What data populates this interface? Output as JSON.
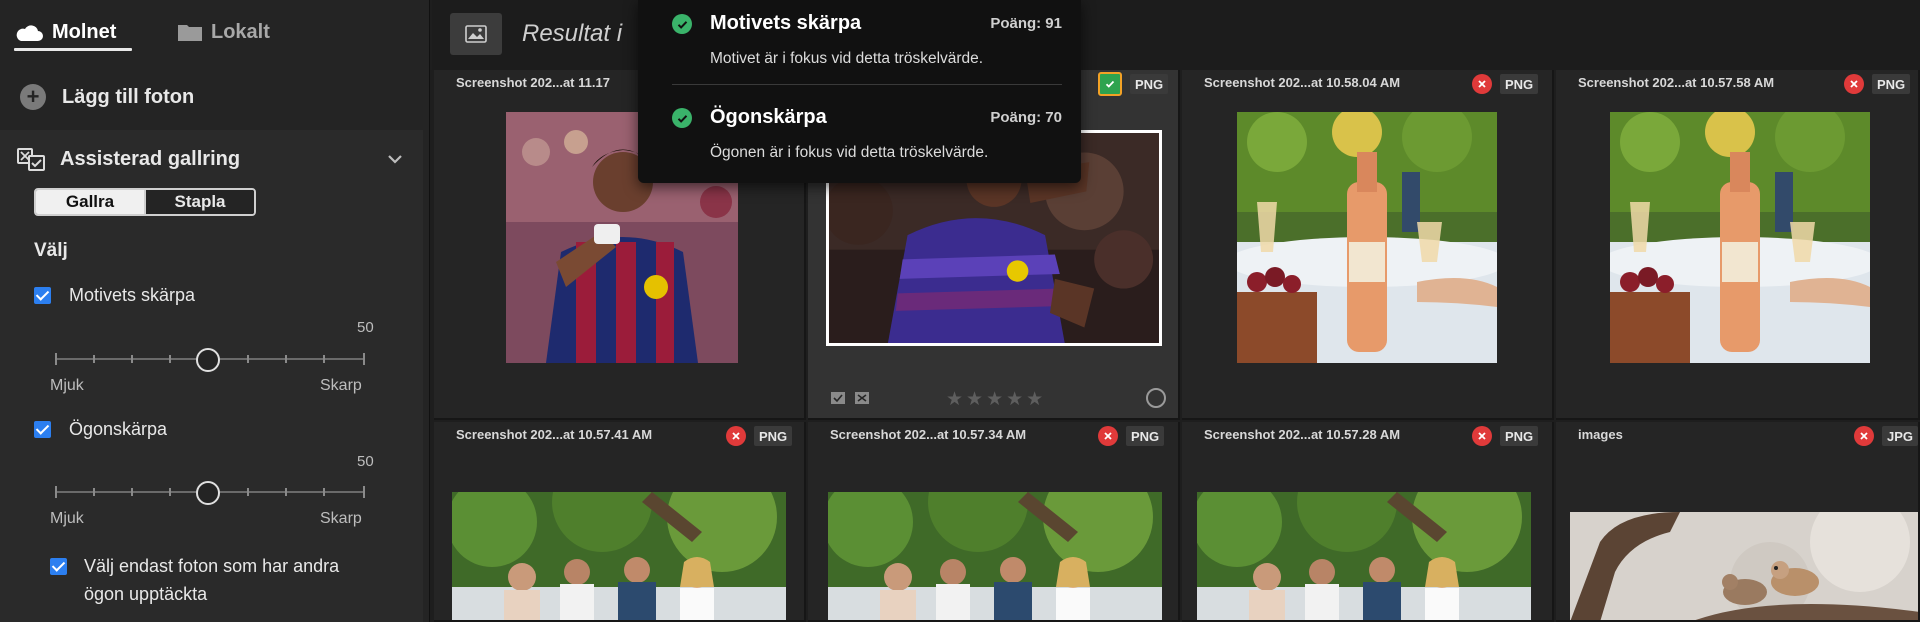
{
  "sidebar": {
    "tabs": [
      {
        "label": "Molnet",
        "active": true,
        "icon": "cloud-icon"
      },
      {
        "label": "Lokalt",
        "active": false,
        "icon": "folder-icon"
      }
    ],
    "add_photos_label": "Lägg till foton",
    "assisted_culling": {
      "title": "Assisterad gallring",
      "mode_options": [
        {
          "label": "Gallra",
          "selected": true
        },
        {
          "label": "Stapla",
          "selected": false
        }
      ],
      "select_label": "Välj",
      "criteria": [
        {
          "label": "Motivets skärpa",
          "checked": true,
          "value": "50",
          "value_level": 0.5,
          "min_label": "Mjuk",
          "max_label": "Skarp"
        },
        {
          "label": "Ögonskärpa",
          "checked": true,
          "value": "50",
          "value_level": 0.5,
          "min_label": "Mjuk",
          "max_label": "Skarp"
        }
      ],
      "eyes_only_label": "Välj endast foton som har andra ögon upptäckta",
      "eyes_only_checked": true
    }
  },
  "main": {
    "results_title": "Resultat i",
    "grid": [
      {
        "name": "Screenshot 202...at 11.17",
        "status": "none",
        "type": "",
        "image": "soccer-celebration"
      },
      {
        "name": "",
        "status": "accepted",
        "type": "PNG",
        "image": "soccer-player",
        "selected": true,
        "rating": "★★★★★"
      },
      {
        "name": "Screenshot 202...at 10.58.04 AM",
        "status": "rejected",
        "type": "PNG",
        "image": "wine-table"
      },
      {
        "name": "Screenshot 202...at 10.57.58 AM",
        "status": "rejected",
        "type": "PNG",
        "image": "wine-table"
      },
      {
        "name": "Screenshot 202...at 10.57.41 AM",
        "status": "rejected",
        "type": "PNG",
        "image": "group-dinner"
      },
      {
        "name": "Screenshot 202...at 10.57.34 AM",
        "status": "rejected",
        "type": "PNG",
        "image": "group-dinner"
      },
      {
        "name": "Screenshot 202...at 10.57.28 AM",
        "status": "rejected",
        "type": "PNG",
        "image": "group-dinner"
      },
      {
        "name": "images",
        "status": "rejected",
        "type": "JPG",
        "image": "birds-branch"
      }
    ]
  },
  "tooltip": {
    "items": [
      {
        "title": "Motivets skärpa",
        "score": "Poäng: 91",
        "desc": "Motivet är i fokus vid detta tröskelvärde."
      },
      {
        "title": "Ögonskärpa",
        "score": "Poäng: 70",
        "desc": "Ögonen är i fokus vid detta tröskelvärde."
      }
    ]
  },
  "colors": {
    "accent": "#2c7ff0",
    "reject": "#e03a3a",
    "accept": "#2ea34f",
    "highlight": "#f3a226"
  }
}
